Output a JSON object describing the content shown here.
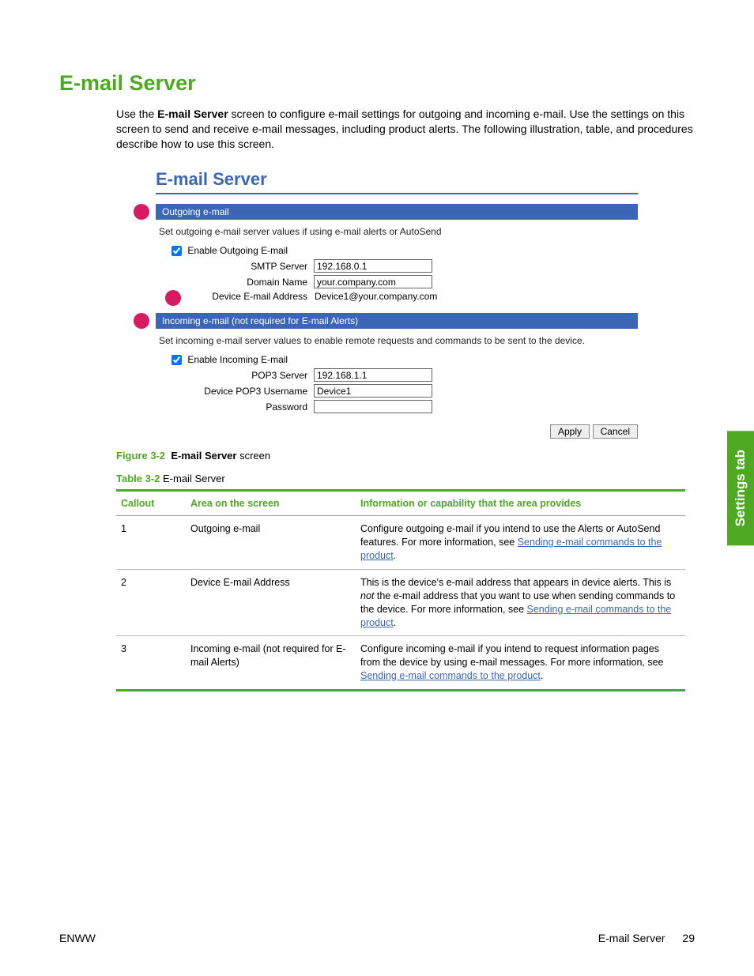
{
  "heading": "E-mail Server",
  "intro_pre": "Use the ",
  "intro_bold": "E-mail Server",
  "intro_post": " screen to configure e-mail settings for outgoing and incoming e-mail. Use the settings on this screen to send and receive e-mail messages, including product alerts. The following illustration, table, and procedures describe how to use this screen.",
  "screenshot": {
    "title": "E-mail Server",
    "outgoing_bar": "Outgoing e-mail",
    "outgoing_desc": "Set outgoing e-mail server values if using e-mail alerts or AutoSend",
    "enable_out": "Enable Outgoing E-mail",
    "smtp_label": "SMTP Server",
    "smtp_value": "192.168.0.1",
    "domain_label": "Domain Name",
    "domain_value": "your.company.com",
    "devaddr_label": "Device E-mail Address",
    "devaddr_value": "Device1@your.company.com",
    "incoming_bar": "Incoming e-mail (not required for E-mail Alerts)",
    "incoming_desc": "Set incoming e-mail server values to enable remote requests and commands to be sent to the device.",
    "enable_in": "Enable Incoming E-mail",
    "pop3_label": "POP3 Server",
    "pop3_value": "192.168.1.1",
    "popuser_label": "Device POP3 Username",
    "popuser_value": "Device1",
    "pass_label": "Password",
    "pass_value": "",
    "apply": "Apply",
    "cancel": "Cancel"
  },
  "fig": {
    "num": "Figure 3-2",
    "title_b": "E-mail Server",
    "title_rest": " screen"
  },
  "tbl": {
    "num": "Table 3-2",
    "title": "  E-mail Server"
  },
  "table": {
    "h1": "Callout",
    "h2": "Area on the screen",
    "h3": "Information or capability that the area provides",
    "rows": [
      {
        "c": "1",
        "a": "Outgoing e-mail",
        "info_pre": "Configure outgoing e-mail if you intend to use the Alerts or AutoSend features. For more information, see ",
        "link": "Sending e-mail commands to the product",
        "info_post": "."
      },
      {
        "c": "2",
        "a": "Device E-mail Address",
        "info_pre": "This is the device's e-mail address that appears in device alerts. This is ",
        "italic": "not",
        "mid": " the e-mail address that you want to use when sending commands to the device. For more information, see ",
        "link": "Sending e-mail commands to the product",
        "info_post": "."
      },
      {
        "c": "3",
        "a": "Incoming e-mail (not required for E-mail Alerts)",
        "info_pre": "Configure incoming e-mail if you intend to request information pages from the device by using e-mail messages. For more information, see ",
        "link": "Sending e-mail commands to the product",
        "info_post": "."
      }
    ]
  },
  "sidetab": "Settings tab",
  "footer": {
    "left": "ENWW",
    "right_label": "E-mail Server",
    "page": "29"
  }
}
